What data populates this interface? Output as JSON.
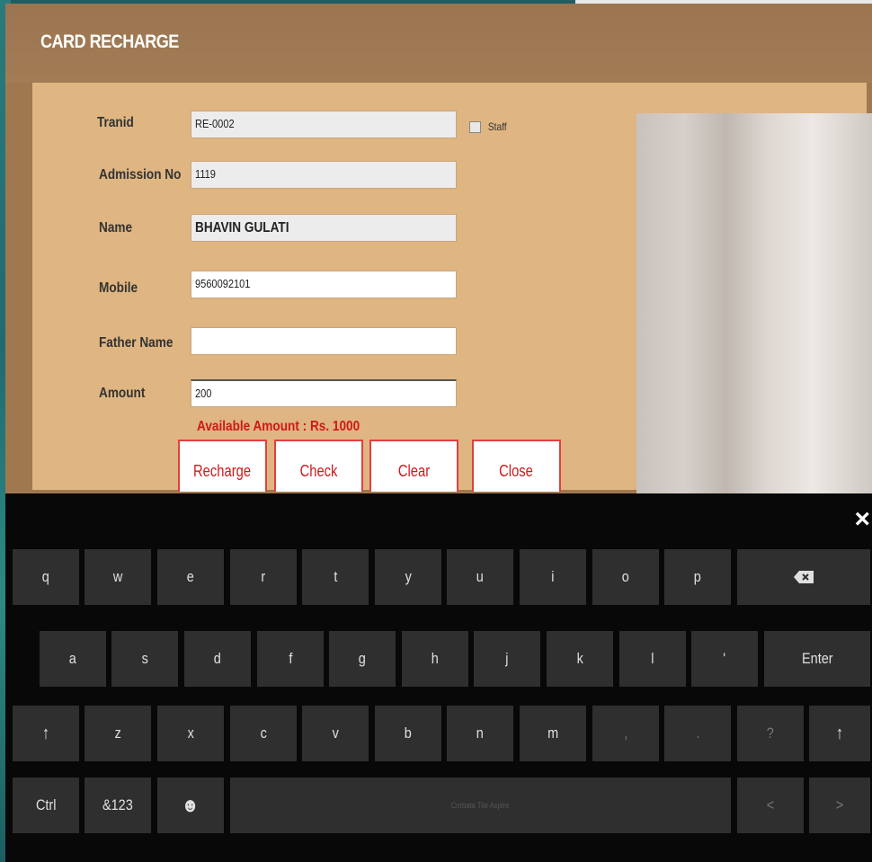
{
  "window": {
    "title": "CARD RECHARGE"
  },
  "form": {
    "tranid": {
      "label": "Tranid",
      "value": "RE-0002"
    },
    "admission": {
      "label": "Admission No",
      "value": "1119"
    },
    "name": {
      "label": "Name",
      "value": "BHAVIN GULATI"
    },
    "mobile": {
      "label": "Mobile",
      "value": "9560092101"
    },
    "father": {
      "label": "Father Name",
      "value": ""
    },
    "amount": {
      "label": "Amount",
      "value": "200"
    },
    "staff_label": "Staff",
    "staff_checked": false,
    "available": "Available Amount : Rs. 1000"
  },
  "buttons": {
    "recharge": "Recharge",
    "check": "Check",
    "clear": "Clear",
    "close": "Close"
  },
  "keyboard": {
    "close_icon": "×",
    "row1": [
      "q",
      "w",
      "e",
      "r",
      "t",
      "y",
      "u",
      "i",
      "o",
      "p"
    ],
    "backspace_icon": "backspace-icon",
    "row2": [
      "a",
      "s",
      "d",
      "f",
      "g",
      "h",
      "j",
      "k",
      "l",
      "'"
    ],
    "enter": "Enter",
    "row3": [
      "z",
      "x",
      "c",
      "v",
      "b",
      "n",
      "m",
      ",",
      ".",
      "?"
    ],
    "shift_icon": "↑",
    "ctrl": "Ctrl",
    "symbols": "&123",
    "emoji_icon": "☻",
    "space_label": "Corbata Tile Aspire",
    "left_arrow": "<",
    "right_arrow": ">"
  },
  "colors": {
    "accent_red": "#d01818",
    "title_bg": "#a0784f",
    "panel_bg": "#dfb582",
    "key_bg": "#2f2f2f"
  }
}
